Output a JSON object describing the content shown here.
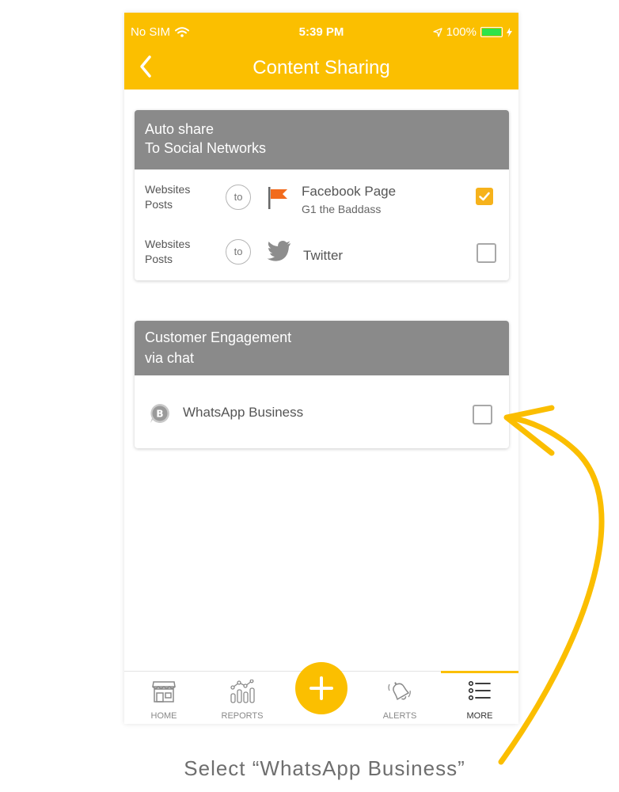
{
  "status_bar": {
    "carrier": "No SIM",
    "time": "5:39 PM",
    "battery": "100%"
  },
  "nav": {
    "title": "Content Sharing"
  },
  "auto_share": {
    "header_line1": "Auto share",
    "header_line2": "To Social Networks",
    "rows": [
      {
        "source_line1": "Websites",
        "source_line2": "Posts",
        "to": "to",
        "name": "Facebook Page",
        "sub": "G1 the Baddass",
        "checked": true,
        "icon": "flag-icon"
      },
      {
        "source_line1": "Websites",
        "source_line2": "Posts",
        "to": "to",
        "name": "Twitter",
        "sub": "",
        "checked": false,
        "icon": "twitter-icon"
      }
    ]
  },
  "engagement": {
    "header_line1": "Customer Engagement",
    "header_line2": "via chat",
    "rows": [
      {
        "name": "WhatsApp Business",
        "checked": false,
        "icon": "whatsapp-business-icon"
      }
    ]
  },
  "tabbar": {
    "tabs": [
      {
        "label": "HOME",
        "icon": "store-icon"
      },
      {
        "label": "REPORTS",
        "icon": "chart-icon"
      },
      {
        "label": "ALERTS",
        "icon": "bell-icon"
      },
      {
        "label": "MORE",
        "icon": "list-icon",
        "active": true
      }
    ],
    "fab_icon": "plus-icon"
  },
  "annotation": {
    "text": "Select “WhatsApp Business”"
  },
  "colors": {
    "brand": "#fbbf00",
    "header_gray": "#8a8a8a",
    "check": "#f6b21b",
    "battery": "#2ee34a"
  }
}
